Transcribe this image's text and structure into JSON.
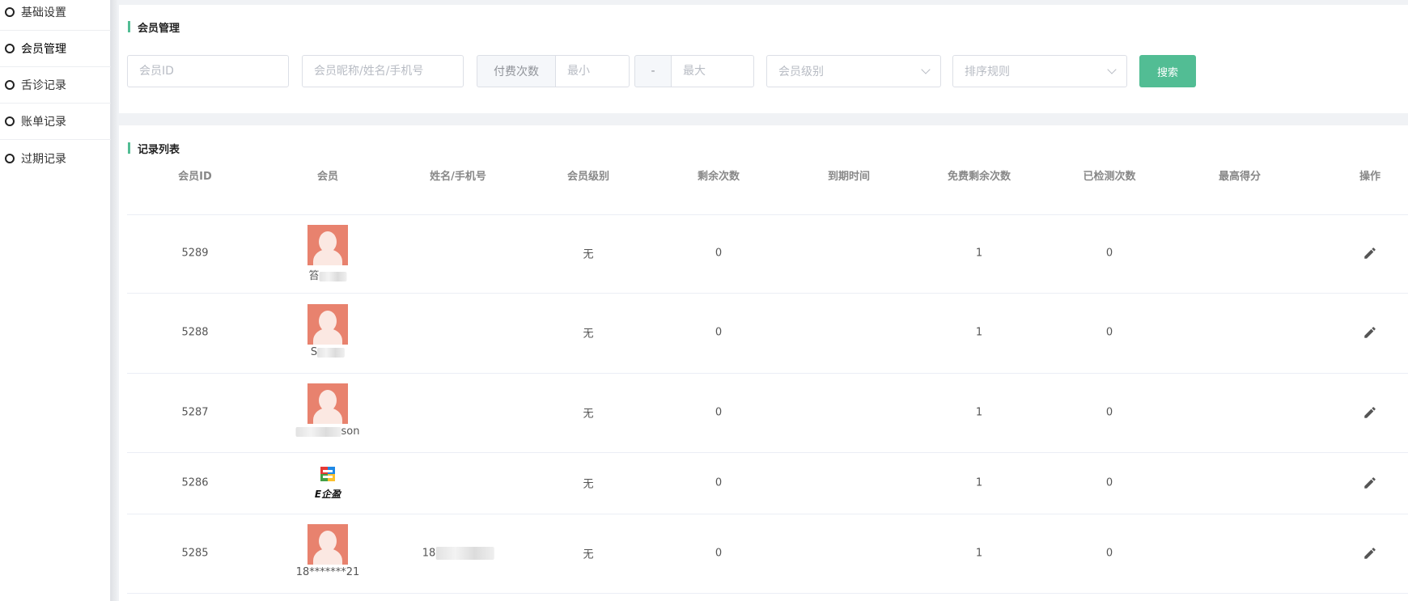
{
  "sidebar": {
    "items": [
      {
        "label": "基础设置",
        "active": false
      },
      {
        "label": "会员管理",
        "active": true
      },
      {
        "label": "舌诊记录",
        "active": false
      },
      {
        "label": "账单记录",
        "active": false
      },
      {
        "label": "过期记录",
        "active": false
      }
    ]
  },
  "search_panel": {
    "title": "会员管理",
    "member_id_placeholder": "会员ID",
    "name_placeholder": "会员昵称/姓名/手机号",
    "paid_count_label": "付费次数",
    "min_placeholder": "最小",
    "range_separator": "-",
    "max_placeholder": "最大",
    "level_placeholder": "会员级别",
    "sort_placeholder": "排序规则",
    "search_button": "搜索"
  },
  "list_panel": {
    "title": "记录列表",
    "columns": [
      "会员ID",
      "会员",
      "姓名/手机号",
      "会员级别",
      "剩余次数",
      "到期时间",
      "免费剩余次数",
      "已检测次数",
      "最高得分",
      "操作"
    ],
    "rows": [
      {
        "id": "5289",
        "nick_visible": "笞",
        "nick_suffix": "",
        "name_phone": "",
        "level": "无",
        "remaining": "0",
        "expire": "",
        "free_remaining": "1",
        "tested": "0",
        "top_score": "",
        "avatar": "default"
      },
      {
        "id": "5288",
        "nick_visible": "S",
        "nick_suffix": "",
        "name_phone": "",
        "level": "无",
        "remaining": "0",
        "expire": "",
        "free_remaining": "1",
        "tested": "0",
        "top_score": "",
        "avatar": "default"
      },
      {
        "id": "5287",
        "nick_visible": "",
        "nick_suffix": "son",
        "name_phone": "",
        "level": "无",
        "remaining": "0",
        "expire": "",
        "free_remaining": "1",
        "tested": "0",
        "top_score": "",
        "avatar": "default"
      },
      {
        "id": "5286",
        "nick_visible": "",
        "nick_suffix": "",
        "name_phone": "",
        "level": "无",
        "remaining": "0",
        "expire": "",
        "free_remaining": "1",
        "tested": "0",
        "top_score": "",
        "avatar": "logo",
        "logo_text": "E企盈"
      },
      {
        "id": "5285",
        "nick_visible": "18*******21",
        "nick_suffix": "",
        "name_phone": "18",
        "level": "无",
        "remaining": "0",
        "expire": "",
        "free_remaining": "1",
        "tested": "0",
        "top_score": "",
        "avatar": "default"
      }
    ]
  },
  "colors": {
    "accent": "#52bd94",
    "avatar_bg": "#e8826e"
  }
}
